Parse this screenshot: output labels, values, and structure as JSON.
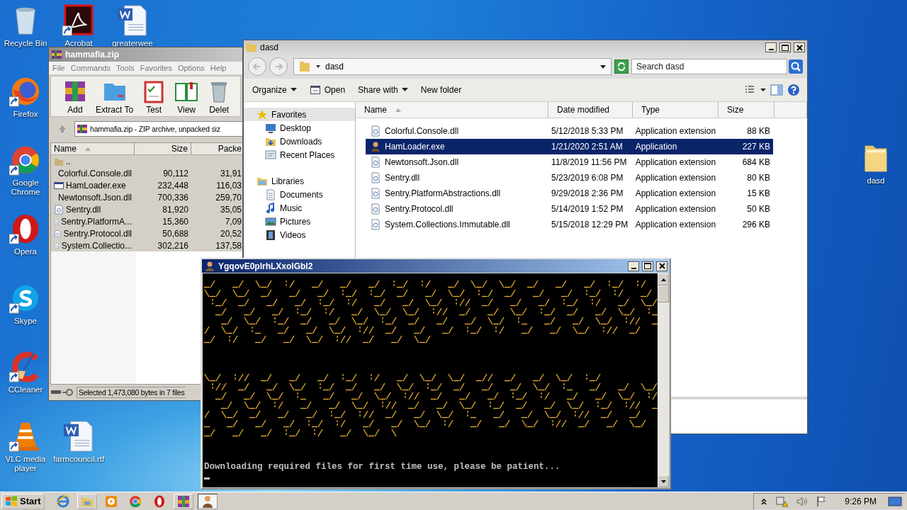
{
  "desktop_icons": [
    {
      "label": "Recycle Bin",
      "kind": "recycle-bin",
      "shortcut": false
    },
    {
      "label": "Acrobat",
      "kind": "acrobat",
      "shortcut": true
    },
    {
      "label": "greaterwee",
      "kind": "word-doc",
      "shortcut": false
    },
    {
      "label": "Firefox",
      "kind": "firefox",
      "shortcut": true
    },
    {
      "label": "Google Chrome",
      "kind": "chrome",
      "shortcut": true
    },
    {
      "label": "Opera",
      "kind": "opera",
      "shortcut": true
    },
    {
      "label": "Skype",
      "kind": "skype",
      "shortcut": true
    },
    {
      "label": "CCleaner",
      "kind": "ccleaner",
      "shortcut": true
    },
    {
      "label": "VLC media player",
      "kind": "vlc",
      "shortcut": true
    },
    {
      "label": "farmcouncil.rtf",
      "kind": "word-doc",
      "shortcut": false
    },
    {
      "label": "dasd",
      "kind": "folder",
      "shortcut": false
    }
  ],
  "archive_window": {
    "title": "hammafia.zip",
    "menu": [
      "File",
      "Commands",
      "Tools",
      "Favorites",
      "Options",
      "Help"
    ],
    "toolbar": [
      {
        "label": "Add",
        "kind": "add"
      },
      {
        "label": "Extract To",
        "kind": "extract"
      },
      {
        "label": "Test",
        "kind": "test"
      },
      {
        "label": "View",
        "kind": "view"
      },
      {
        "label": "Delet",
        "kind": "delete"
      }
    ],
    "address": "hammafia.zip - ZIP archive, unpacked siz",
    "columns": [
      {
        "label": "Name",
        "sorted": true
      },
      {
        "label": "Size",
        "sorted": false
      },
      {
        "label": "Packe",
        "sorted": false
      }
    ],
    "rows": [
      {
        "name": "..",
        "kind": "parent",
        "selected": true
      },
      {
        "name": "Colorful.Console.dll",
        "kind": "dll",
        "size": "90,112",
        "packed": "31,91",
        "selected": true
      },
      {
        "name": "HamLoader.exe",
        "kind": "exe",
        "size": "232,448",
        "packed": "116,03",
        "selected": true
      },
      {
        "name": "Newtonsoft.Json.dll",
        "kind": "dll",
        "size": "700,336",
        "packed": "259,70",
        "selected": true
      },
      {
        "name": "Sentry.dll",
        "kind": "dll",
        "size": "81,920",
        "packed": "35,05",
        "selected": true
      },
      {
        "name": "Sentry.PlatformA...",
        "kind": "dll",
        "size": "15,360",
        "packed": "7,09",
        "selected": true
      },
      {
        "name": "Sentry.Protocol.dll",
        "kind": "dll",
        "size": "50,688",
        "packed": "20,52",
        "selected": true
      },
      {
        "name": "System.Collectio...",
        "kind": "dll",
        "size": "302,216",
        "packed": "137,58",
        "selected": true
      }
    ],
    "status_bar": "Selected 1,473,080 bytes in 7 files"
  },
  "explorer_window": {
    "title": "dasd",
    "breadcrumb": "dasd",
    "search": {
      "placeholder": "Search dasd"
    },
    "commands": [
      {
        "label": "Organize",
        "kind": "menu"
      },
      {
        "label": "Open",
        "kind": "open"
      },
      {
        "label": "Share with",
        "kind": "menu"
      },
      {
        "label": "New folder",
        "kind": "plain"
      }
    ],
    "navigation": [
      {
        "label": "Favorites",
        "kind": "favorites",
        "selected": true,
        "children": [
          {
            "label": "Desktop",
            "kind": "desktop",
            "selected": false
          },
          {
            "label": "Downloads",
            "kind": "downloads",
            "selected": false
          },
          {
            "label": "Recent Places",
            "kind": "recent",
            "selected": false
          }
        ]
      },
      {
        "label": "Libraries",
        "kind": "libraries",
        "selected": false,
        "children": [
          {
            "label": "Documents",
            "kind": "documents",
            "selected": false
          },
          {
            "label": "Music",
            "kind": "music",
            "selected": false
          },
          {
            "label": "Pictures",
            "kind": "pictures",
            "selected": false
          },
          {
            "label": "Videos",
            "kind": "videos",
            "selected": false
          }
        ]
      }
    ],
    "columns": [
      {
        "label": "Name",
        "sorted": true
      },
      {
        "label": "Date modified",
        "sorted": false
      },
      {
        "label": "Type",
        "sorted": false
      },
      {
        "label": "Size",
        "sorted": false
      }
    ],
    "rows": [
      {
        "name": "Colorful.Console.dll",
        "kind": "dll",
        "date": "5/12/2018 5:33 PM",
        "type": "Application extension",
        "size": "88 KB",
        "selected": false
      },
      {
        "name": "HamLoader.exe",
        "kind": "exe",
        "date": "1/21/2020 2:51 AM",
        "type": "Application",
        "size": "227 KB",
        "selected": true
      },
      {
        "name": "Newtonsoft.Json.dll",
        "kind": "dll",
        "date": "11/8/2019 11:56 PM",
        "type": "Application extension",
        "size": "684 KB",
        "selected": false
      },
      {
        "name": "Sentry.dll",
        "kind": "dll",
        "date": "5/23/2019 6:08 PM",
        "type": "Application extension",
        "size": "80 KB",
        "selected": false
      },
      {
        "name": "Sentry.PlatformAbstractions.dll",
        "kind": "dll",
        "date": "9/29/2018 2:36 PM",
        "type": "Application extension",
        "size": "15 KB",
        "selected": false
      },
      {
        "name": "Sentry.Protocol.dll",
        "kind": "dll",
        "date": "5/14/2019 1:52 PM",
        "type": "Application extension",
        "size": "50 KB",
        "selected": false
      },
      {
        "name": "System.Collections.Immutable.dll",
        "kind": "dll",
        "date": "5/15/2018 12:29 PM",
        "type": "Application extension",
        "size": "296 KB",
        "selected": false
      }
    ]
  },
  "console_window": {
    "title": "YgqovE0plrhLXxolGbl2",
    "lines": [
      "Downloading required files for first time use, please be patient..."
    ]
  },
  "taskbar": {
    "start": "Start",
    "apps": [
      {
        "kind": "ie",
        "open": false,
        "active": false
      },
      {
        "kind": "explorer",
        "open": true,
        "active": false
      },
      {
        "kind": "media",
        "open": false,
        "active": false
      },
      {
        "kind": "chrome",
        "open": false,
        "active": false
      },
      {
        "kind": "opera",
        "open": false,
        "active": false
      },
      {
        "kind": "winrar",
        "open": true,
        "active": false
      },
      {
        "kind": "hamloader",
        "open": true,
        "active": true
      }
    ],
    "clock": "9:26 PM"
  }
}
